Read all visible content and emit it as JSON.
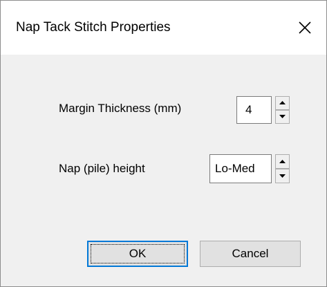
{
  "window": {
    "title": "Nap Tack Stitch Properties",
    "close_icon": "close-icon"
  },
  "margin": {
    "label": "Margin Thickness (mm)",
    "value": "4"
  },
  "nap": {
    "label": "Nap (pile) height",
    "value": "Lo-Med"
  },
  "buttons": {
    "ok": "OK",
    "cancel": "Cancel"
  },
  "colors": {
    "dialog_background": "#f0f0f0",
    "titlebar_background": "#ffffff",
    "default_button_border": "#0078d7",
    "button_face": "#e1e1e1"
  }
}
